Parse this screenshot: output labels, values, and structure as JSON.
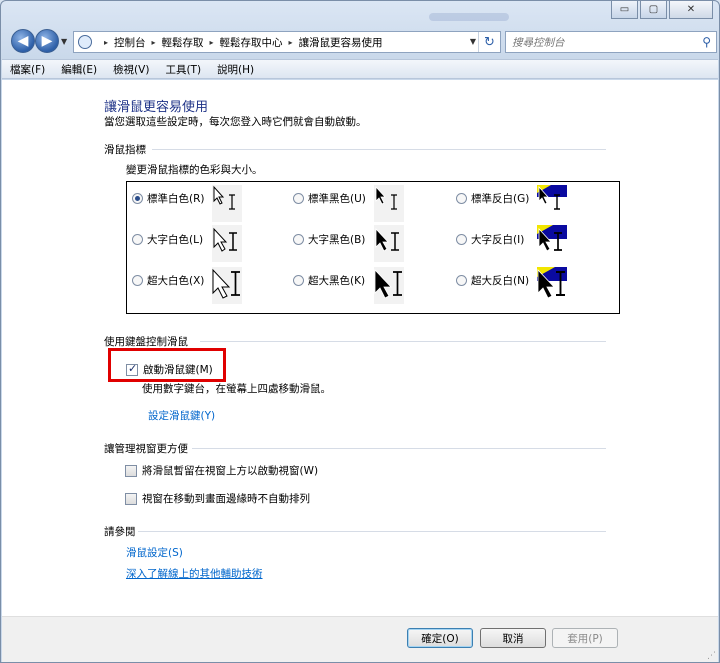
{
  "window": {
    "controls": {
      "minimize": "▭",
      "maximize": "▢",
      "close": "✕"
    }
  },
  "nav": {
    "back_icon": "◀",
    "forward_icon": "▶",
    "dropdown_icon": "▼",
    "breadcrumb": [
      "控制台",
      "輕鬆存取",
      "輕鬆存取中心",
      "讓滑鼠更容易使用"
    ],
    "refresh_icon": "↻",
    "search_placeholder": "搜尋控制台",
    "search_icon": "⚲"
  },
  "menu": [
    "檔案(F)",
    "編輯(E)",
    "檢視(V)",
    "工具(T)",
    "說明(H)"
  ],
  "page": {
    "title": "讓滑鼠更容易使用",
    "subtitle": "當您選取這些設定時，每次您登入時它們就會自動啟動。"
  },
  "pointers": {
    "heading": "滑鼠指標",
    "description": "變更滑鼠指標的色彩與大小。",
    "options": [
      {
        "label": "標準白色(R)",
        "selected": true
      },
      {
        "label": "標準黑色(U)",
        "selected": false
      },
      {
        "label": "標準反白(G)",
        "selected": false
      },
      {
        "label": "大字白色(L)",
        "selected": false
      },
      {
        "label": "大字黑色(B)",
        "selected": false
      },
      {
        "label": "大字反白(I)",
        "selected": false
      },
      {
        "label": "超大白色(X)",
        "selected": false
      },
      {
        "label": "超大黑色(K)",
        "selected": false
      },
      {
        "label": "超大反白(N)",
        "selected": false
      }
    ]
  },
  "keyboard": {
    "heading": "使用鍵盤控制滑鼠",
    "mousekeys_label": "啟動滑鼠鍵(M)",
    "mousekeys_checked": true,
    "mousekeys_desc": "使用數字鍵台，在螢幕上四處移動滑鼠。",
    "setup_link": "設定滑鼠鍵(Y)"
  },
  "windows": {
    "heading": "讓管理視窗更方便",
    "hover_label": "將滑鼠暫留在視窗上方以啟動視窗(W)",
    "snap_label": "視窗在移動到畫面邊緣時不自動排列"
  },
  "see_also": {
    "heading": "請參閱",
    "mouse_settings_link": "滑鼠設定(S)",
    "online_link": "深入了解線上的其他輔助技術"
  },
  "buttons": {
    "ok": "確定(O)",
    "cancel": "取消",
    "apply": "套用(P)"
  },
  "colors": {
    "title": "#1e3287",
    "link": "#0066cc",
    "highlight": "#e00000",
    "inverse_bg": "#0a0aa0",
    "inverse_top": "#f2e600"
  }
}
